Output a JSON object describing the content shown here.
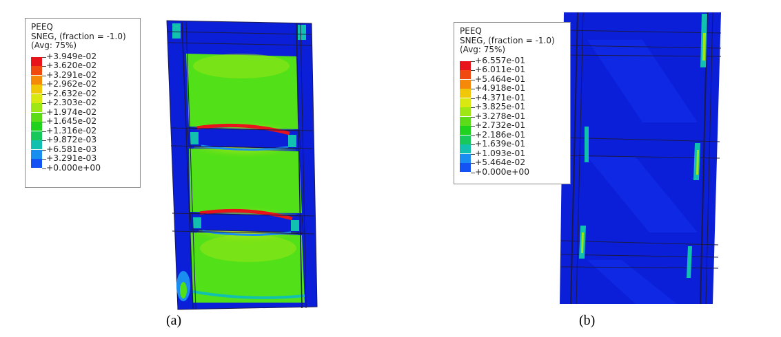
{
  "panels": [
    {
      "id": "a",
      "caption": "(a)",
      "legend": {
        "lines": [
          "PEEQ",
          "SNEG, (fraction = -1.0)",
          "(Avg: 75%)"
        ],
        "values": [
          "+3.949e-02",
          "+3.620e-02",
          "+3.291e-02",
          "+2.962e-02",
          "+2.632e-02",
          "+2.303e-02",
          "+1.974e-02",
          "+1.645e-02",
          "+1.316e-02",
          "+9.872e-03",
          "+6.581e-03",
          "+3.291e-03",
          "+0.000e+00"
        ]
      }
    },
    {
      "id": "b",
      "caption": "(b)",
      "legend": {
        "lines": [
          "PEEQ",
          "SNEG, (fraction = -1.0)",
          "(Avg: 75%)"
        ],
        "values": [
          "+6.557e-01",
          "+6.011e-01",
          "+5.464e-01",
          "+4.918e-01",
          "+4.371e-01",
          "+3.825e-01",
          "+3.278e-01",
          "+2.732e-01",
          "+2.186e-01",
          "+1.639e-01",
          "+1.093e-01",
          "+5.464e-02",
          "+0.000e+00"
        ]
      }
    }
  ],
  "colors": {
    "scale": [
      "#e8141c",
      "#f04a10",
      "#f58a0a",
      "#f0c808",
      "#d8e810",
      "#9ee614",
      "#5cdc18",
      "#1ed21e",
      "#18c85a",
      "#12c0b0",
      "#1a8ef0",
      "#1452f4",
      "#0a1ee6"
    ],
    "deep_blue": "#0b1fd8",
    "panel_green": "#52e018",
    "edge": "#1a1a4a"
  }
}
